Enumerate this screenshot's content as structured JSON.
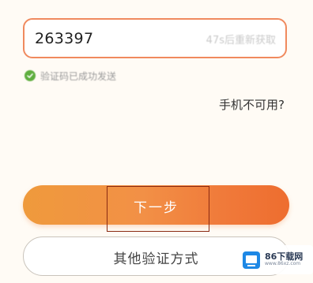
{
  "code_input": {
    "value": "263397",
    "resend_hint": "47s后重新获取"
  },
  "status": {
    "sent_text": "验证码已成功发送",
    "icon": "check-circle-icon",
    "icon_color": "#5fae3f"
  },
  "links": {
    "phone_unavailable": "手机不可用?"
  },
  "buttons": {
    "next_label": "下一步",
    "other_method_label": "其他验证方式"
  },
  "watermark": {
    "name": "86下载网",
    "url": "www.86xz.com"
  },
  "colors": {
    "accent": "#f08a5e",
    "button_gradient_start": "#ef9a3c",
    "button_gradient_end": "#ee6d2f",
    "highlight_box": "#8a2a12"
  }
}
